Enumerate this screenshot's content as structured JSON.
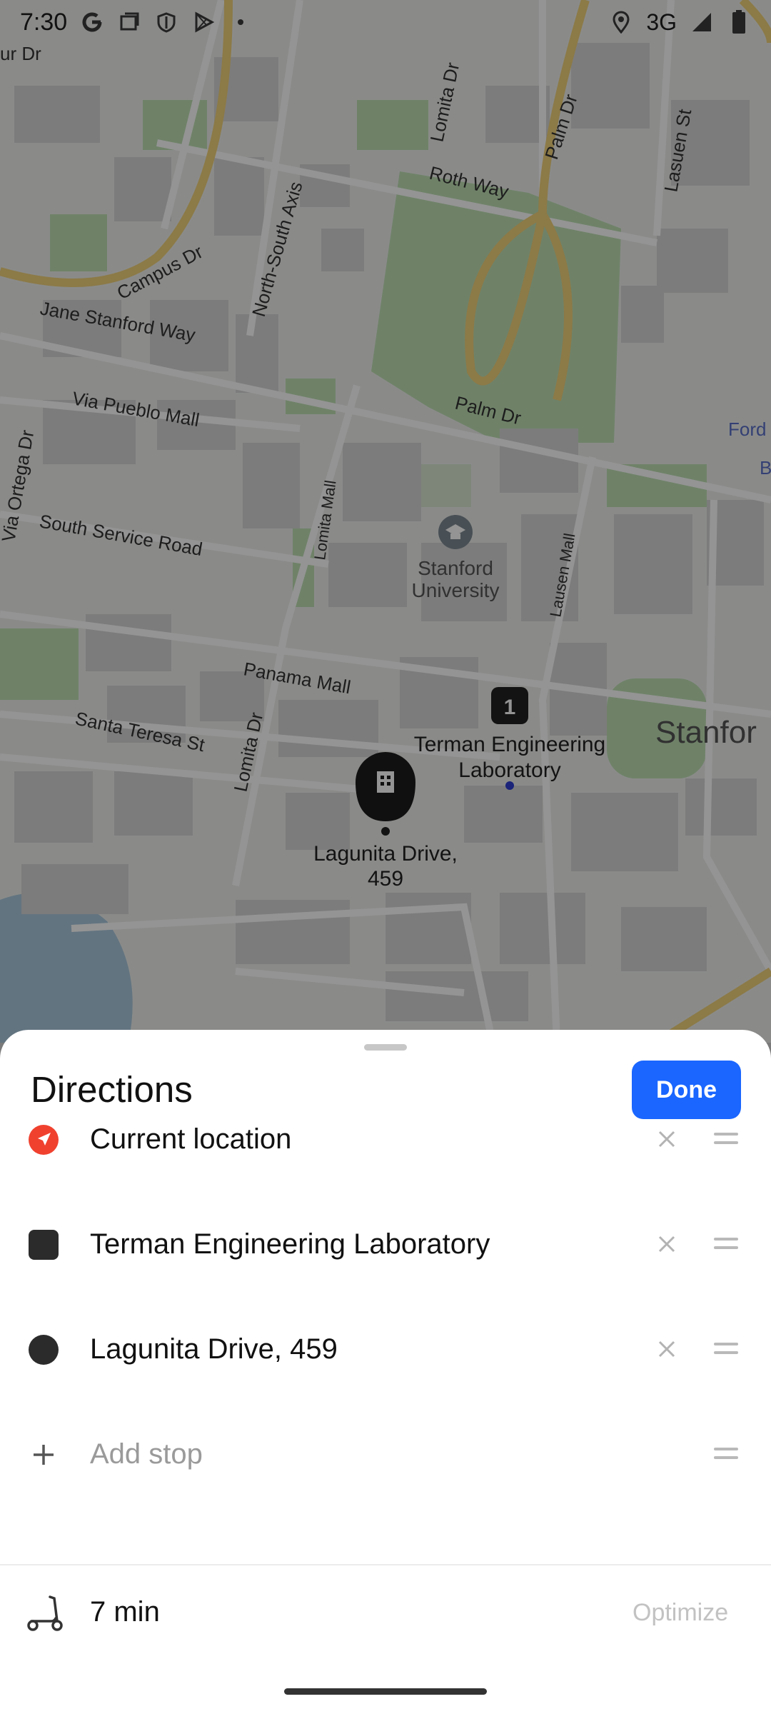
{
  "status_bar": {
    "time": "7:30",
    "network": "3G",
    "left_icons": [
      "google-g-icon",
      "screenshot-icon",
      "shield-icon",
      "play-store-icon",
      "dot-icon"
    ],
    "right_icons": [
      "location-icon",
      "signal-icon",
      "battery-icon"
    ]
  },
  "map": {
    "labels": {
      "roth_way": "Roth Way",
      "lomita_dr_top": "Lomita Dr",
      "palm_dr_top": "Palm Dr",
      "lasuen_st": "Lasuen St",
      "campus_dr": "Campus Dr",
      "north_south_axis": "North-South Axis",
      "jane_stanford_way": "Jane Stanford Way",
      "via_pueblo_mall": "Via Pueblo Mall",
      "palm_dr": "Palm Dr",
      "ford": "Ford",
      "b": "B",
      "via_ortega_dr": "Via Ortega Dr",
      "lomita_mall": "Lomita Mall",
      "lausen_mall": "Lausen Mall",
      "south_service_road": "South Service Road",
      "stanford_univ_1": "Stanford",
      "stanford_univ_2": "University",
      "panama_mall": "Panama Mall",
      "santa_teresa_st": "Santa Teresa St",
      "lomita_dr": "Lomita Dr",
      "stanford_right": "Stanfor",
      "terman_1": "Terman Engineering",
      "terman_2": "Laboratory",
      "lagunita_1": "Lagunita Drive,",
      "lagunita_2": "459",
      "ur_dr": "ur Dr"
    },
    "marker_number": "1"
  },
  "sheet": {
    "title": "Directions",
    "done_label": "Done",
    "stops": [
      {
        "label": "Current location",
        "icon": "navigation-arrow-icon"
      },
      {
        "label": "Terman Engineering Laboratory",
        "icon": "square-waypoint-icon"
      },
      {
        "label": "Lagunita Drive, 459",
        "icon": "circle-destination-icon"
      }
    ],
    "add_stop_label": "Add stop",
    "duration": "7 min",
    "optimize_label": "Optimize",
    "transport_icon": "scooter-icon"
  },
  "colors": {
    "accent": "#1a66ff",
    "current_location": "#f0412f",
    "waypoint": "#2b2b2b"
  }
}
